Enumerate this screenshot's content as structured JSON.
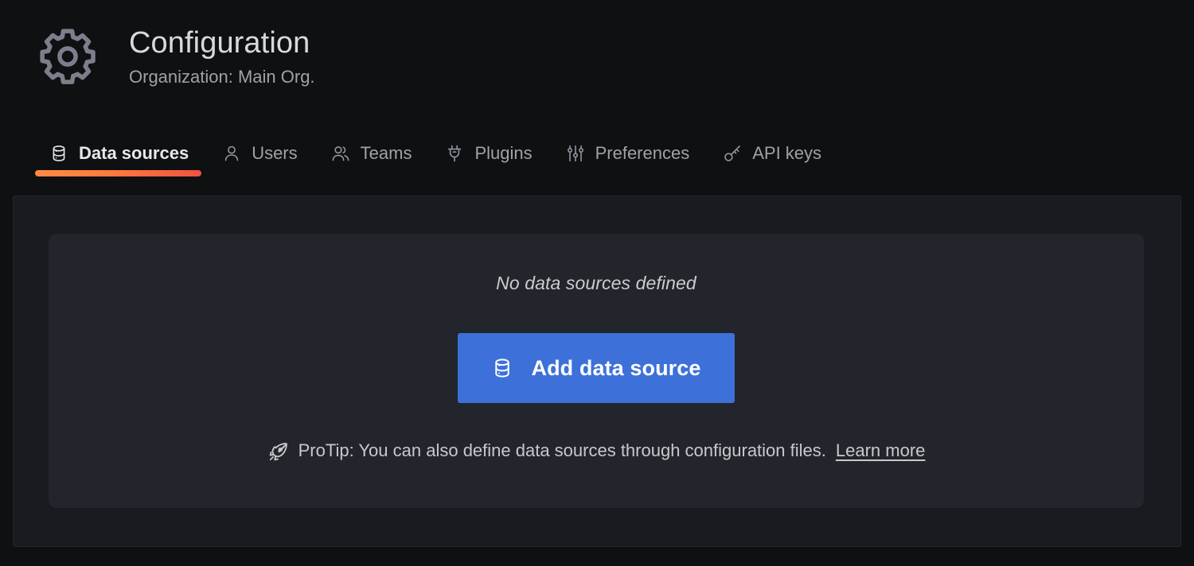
{
  "header": {
    "icon": "gear-icon",
    "title": "Configuration",
    "subtitle": "Organization: Main Org."
  },
  "tabs": [
    {
      "id": "data-sources",
      "label": "Data sources",
      "icon": "database-icon",
      "active": true
    },
    {
      "id": "users",
      "label": "Users",
      "icon": "user-icon",
      "active": false
    },
    {
      "id": "teams",
      "label": "Teams",
      "icon": "users-icon",
      "active": false
    },
    {
      "id": "plugins",
      "label": "Plugins",
      "icon": "plug-icon",
      "active": false
    },
    {
      "id": "preferences",
      "label": "Preferences",
      "icon": "sliders-icon",
      "active": false
    },
    {
      "id": "api-keys",
      "label": "API keys",
      "icon": "key-icon",
      "active": false
    }
  ],
  "main": {
    "empty_message": "No data sources defined",
    "add_button": {
      "label": "Add data source",
      "icon": "database-icon"
    },
    "protip": {
      "icon": "rocket-icon",
      "text": "ProTip: You can also define data sources through configuration files.",
      "link_label": "Learn more"
    }
  },
  "colors": {
    "page_background": "#0E1012",
    "panel_background": "#181B1F",
    "card_background": "#22252B",
    "primary_button": "#3D71D9",
    "active_tab_gradient_start": "#FF8B42",
    "active_tab_gradient_end": "#F2533F",
    "text_primary": "#D8D9DA",
    "text_secondary": "#9FA2A8"
  }
}
